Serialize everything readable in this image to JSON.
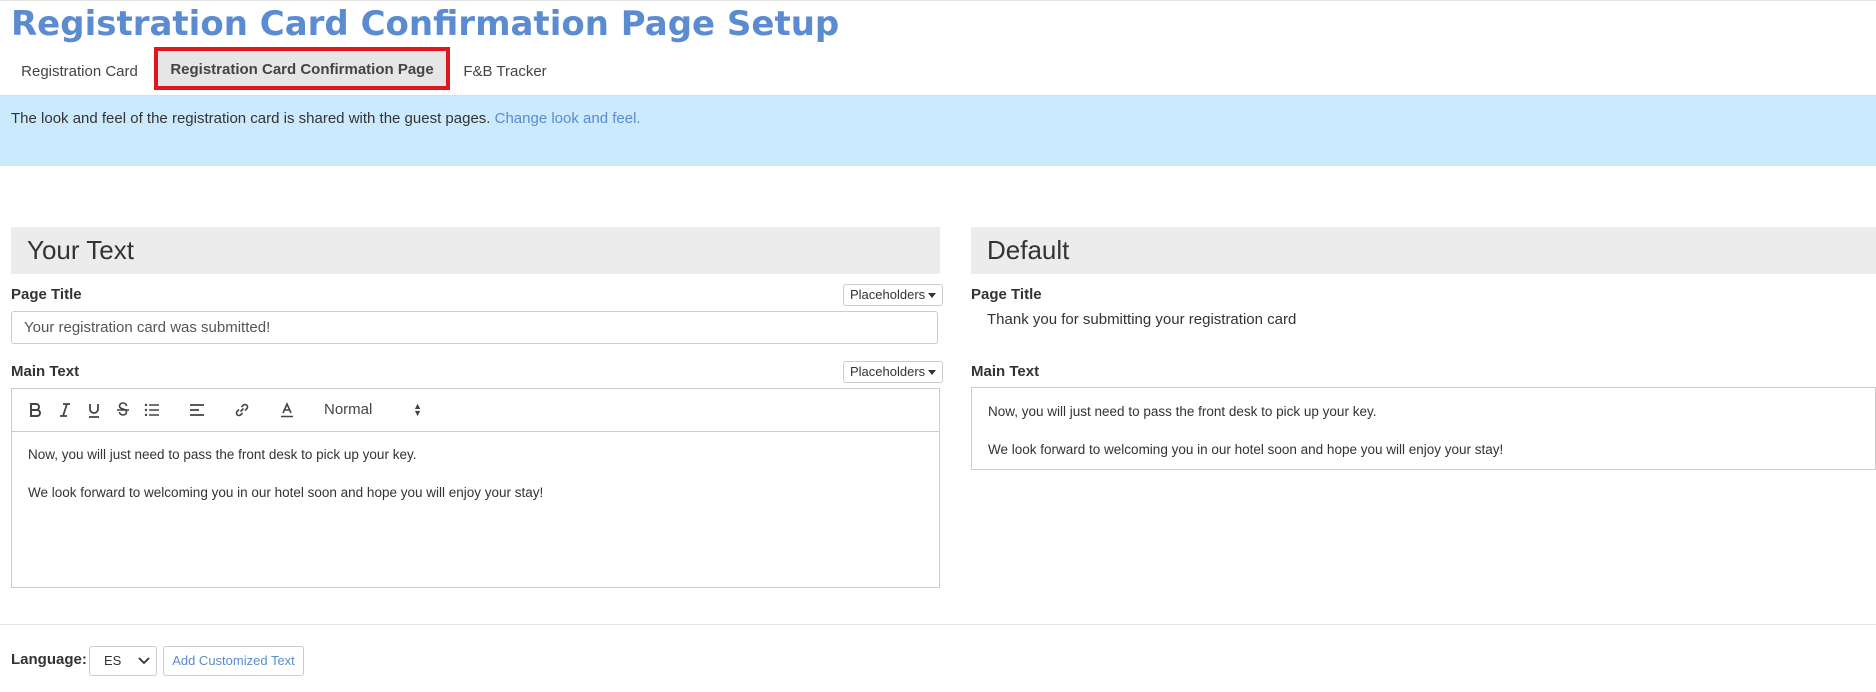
{
  "page": {
    "title": "Registration Card Confirmation Page Setup"
  },
  "tabs": [
    {
      "label": "Registration Card"
    },
    {
      "label": "Registration Card Confirmation Page",
      "active": true
    },
    {
      "label": "F&B Tracker"
    }
  ],
  "info": {
    "message": "The look and feel of the registration card is shared with the guest pages.",
    "link": "Change look and feel."
  },
  "your_text": {
    "heading": "Your Text",
    "page_title_label": "Page Title",
    "page_title_value": "Your registration card was submitted!",
    "placeholders_label": "Placeholders",
    "main_text_label": "Main Text",
    "toolbar": {
      "size_value": "Normal",
      "icons": [
        "bold-icon",
        "italic-icon",
        "underline-icon",
        "strikethrough-icon",
        "bullet-list-icon",
        "align-icon",
        "link-icon",
        "text-color-icon"
      ]
    },
    "main_text": [
      "Now, you will just need to pass the front desk to pick up your key.",
      "We look forward to welcoming you in our hotel soon and hope you will enjoy your stay!"
    ]
  },
  "default": {
    "heading": "Default",
    "page_title_label": "Page Title",
    "page_title_value": "Thank you for submitting your registration card",
    "main_text_label": "Main Text",
    "main_text": [
      "Now, you will just need to pass the front desk to pick up your key.",
      "We look forward to welcoming you in our hotel soon and hope you will enjoy your stay!"
    ]
  },
  "footer": {
    "language_label": "Language:",
    "language_value": "ES",
    "add_button": "Add Customized Text"
  },
  "colors": {
    "accent": "#5b8bd0",
    "info_bg": "#cceafe",
    "highlight": "#e1151f"
  }
}
